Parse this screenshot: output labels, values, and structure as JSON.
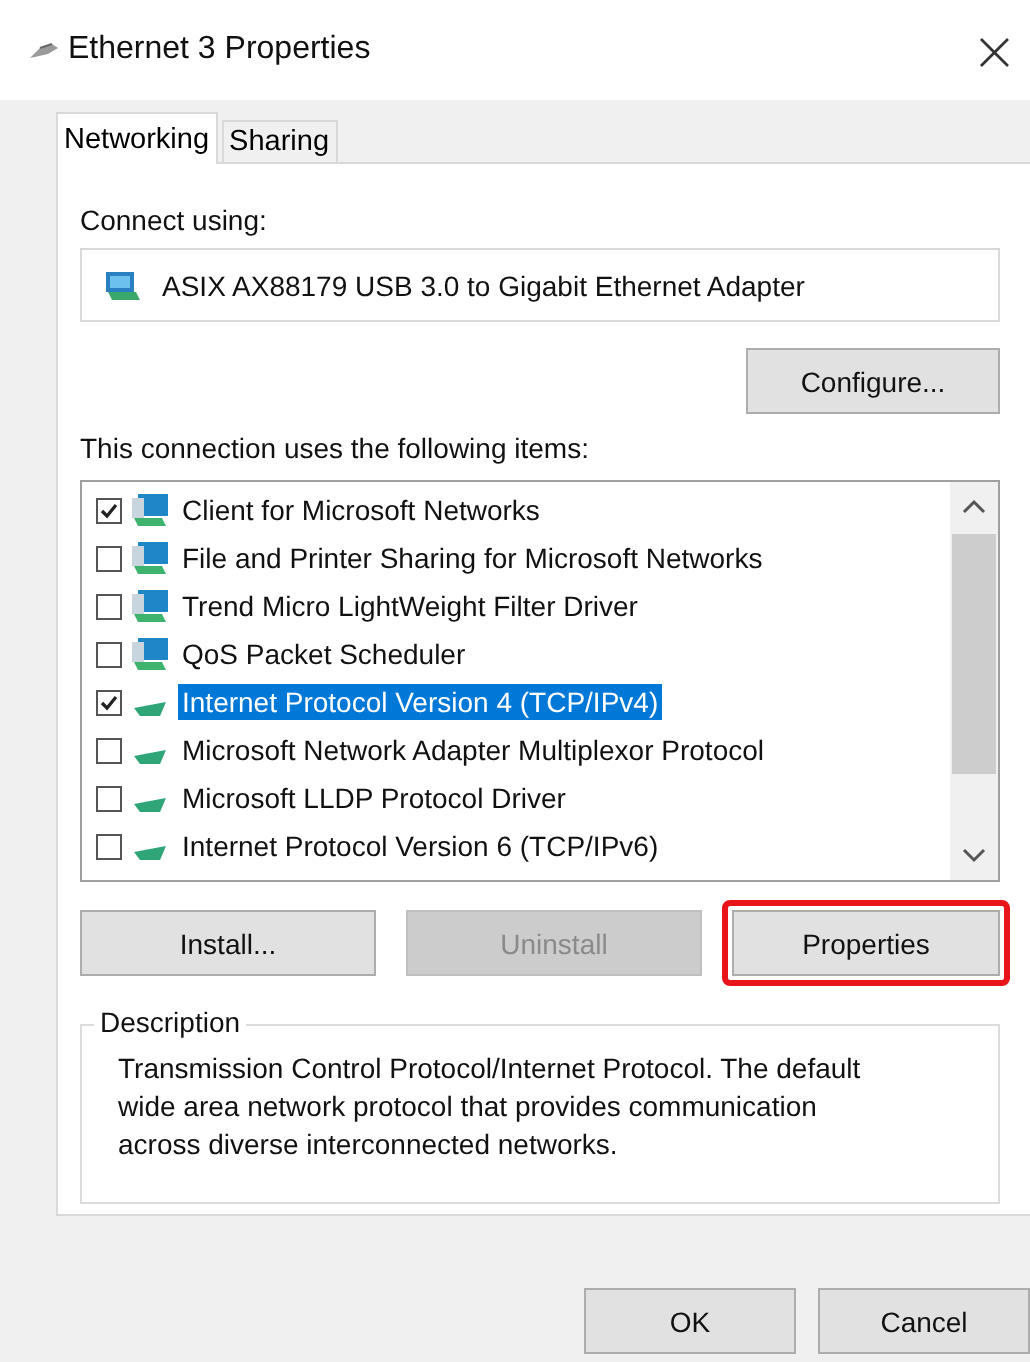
{
  "window": {
    "title": "Ethernet 3 Properties",
    "close": "×"
  },
  "tabs": [
    {
      "label": "Networking",
      "selected": true
    },
    {
      "label": "Sharing",
      "selected": false
    }
  ],
  "connect_using": {
    "label": "Connect using:",
    "adapter": "ASIX AX88179 USB 3.0 to Gigabit Ethernet Adapter"
  },
  "configure_button": "Configure...",
  "items_label": "This connection uses the following items:",
  "items": [
    {
      "label": "Client for Microsoft Networks",
      "checked": true,
      "selected": false,
      "kind": "service"
    },
    {
      "label": "File and Printer Sharing for Microsoft Networks",
      "checked": false,
      "selected": false,
      "kind": "service"
    },
    {
      "label": "Trend Micro LightWeight Filter Driver",
      "checked": false,
      "selected": false,
      "kind": "service"
    },
    {
      "label": "QoS Packet Scheduler",
      "checked": false,
      "selected": false,
      "kind": "service"
    },
    {
      "label": "Internet Protocol Version 4 (TCP/IPv4)",
      "checked": true,
      "selected": true,
      "kind": "protocol"
    },
    {
      "label": "Microsoft Network Adapter Multiplexor Protocol",
      "checked": false,
      "selected": false,
      "kind": "protocol"
    },
    {
      "label": "Microsoft LLDP Protocol Driver",
      "checked": false,
      "selected": false,
      "kind": "protocol"
    },
    {
      "label": "Internet Protocol Version 6 (TCP/IPv6)",
      "checked": false,
      "selected": false,
      "kind": "protocol"
    }
  ],
  "buttons": [
    {
      "label": "Install...",
      "disabled": false,
      "highlighted": false
    },
    {
      "label": "Uninstall",
      "disabled": true,
      "highlighted": false
    },
    {
      "label": "Properties",
      "disabled": false,
      "highlighted": true
    }
  ],
  "description": {
    "title": "Description",
    "text": "Transmission Control Protocol/Internet Protocol. The default wide area network protocol that provides communication across diverse interconnected networks."
  },
  "dialog_buttons": [
    "OK",
    "Cancel"
  ]
}
